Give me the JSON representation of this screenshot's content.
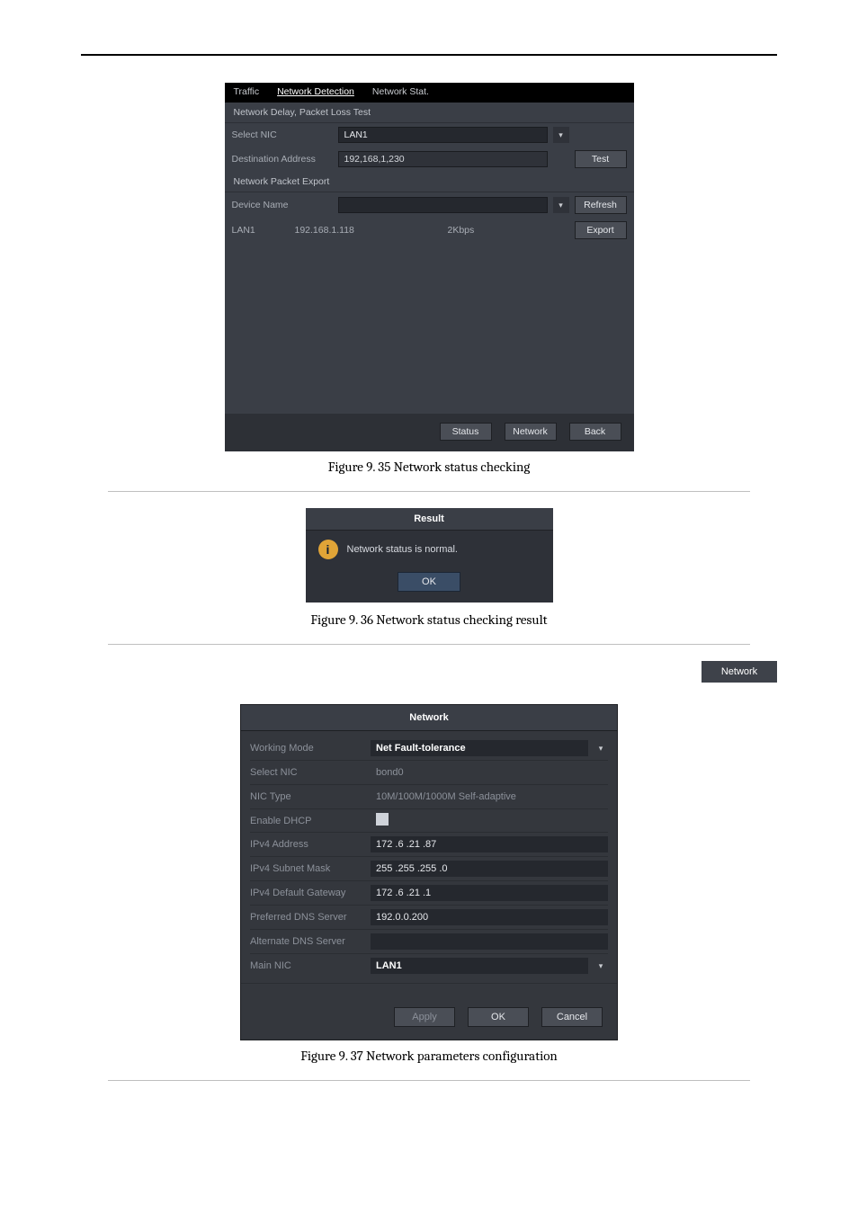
{
  "figure1": {
    "tabs": [
      "Traffic",
      "Network Detection",
      "Network Stat."
    ],
    "active_tab_index": 1,
    "section_a_title": "Network Delay, Packet Loss Test",
    "select_nic_label": "Select NIC",
    "select_nic_value": "LAN1",
    "dest_addr_label": "Destination Address",
    "dest_addr_value": "192,168,1,230",
    "test_btn": "Test",
    "section_b_title": "Network Packet Export",
    "device_name_label": "Device Name",
    "refresh_btn": "Refresh",
    "row_name": "LAN1",
    "row_ip": "192.168.1.118",
    "row_rate": "2Kbps",
    "export_btn": "Export",
    "footer": {
      "status": "Status",
      "network": "Network",
      "back": "Back"
    }
  },
  "caption1": "Figure 9. 35 Network status checking",
  "figure2": {
    "title": "Result",
    "message": "Network status is normal.",
    "ok": "OK"
  },
  "caption2": "Figure 9. 36 Network status checking result",
  "inline_network_btn": "Network",
  "figure3": {
    "title": "Network",
    "fields": {
      "working_mode_label": "Working Mode",
      "working_mode_value": "Net Fault-tolerance",
      "select_nic_label": "Select NIC",
      "select_nic_value": "bond0",
      "nic_type_label": "NIC Type",
      "nic_type_value": "10M/100M/1000M Self-adaptive",
      "enable_dhcp_label": "Enable DHCP",
      "ipv4_addr_label": "IPv4 Address",
      "ipv4_addr_value": "172 .6    .21  .87",
      "ipv4_mask_label": "IPv4 Subnet Mask",
      "ipv4_mask_value": "255 .255 .255 .0",
      "ipv4_gw_label": "IPv4 Default Gateway",
      "ipv4_gw_value": "172 .6    .21  .1",
      "pref_dns_label": "Preferred DNS Server",
      "pref_dns_value": "192.0.0.200",
      "alt_dns_label": "Alternate DNS Server",
      "alt_dns_value": "",
      "main_nic_label": "Main NIC",
      "main_nic_value": "LAN1"
    },
    "buttons": {
      "apply": "Apply",
      "ok": "OK",
      "cancel": "Cancel"
    }
  },
  "caption3": "Figure 9. 37 Network parameters configuration"
}
